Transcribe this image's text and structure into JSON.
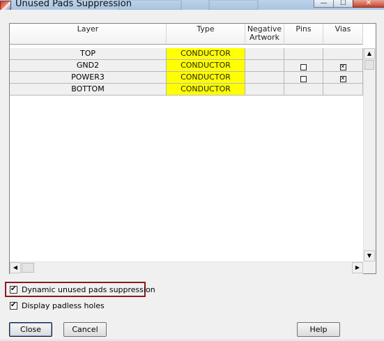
{
  "window": {
    "title": "Unused Pads Suppression",
    "controls": {
      "minimize": "—",
      "maximize": "☐",
      "close": "✕"
    }
  },
  "table": {
    "columns": [
      "Layer",
      "Type",
      "Negative\nArtwork",
      "Pins",
      "Vias"
    ],
    "rows": [
      {
        "layer": "TOP",
        "type": "CONDUCTOR",
        "negative": "",
        "pins": null,
        "vias": null
      },
      {
        "layer": "GND2",
        "type": "CONDUCTOR",
        "negative": "",
        "pins": false,
        "vias": true
      },
      {
        "layer": "POWER3",
        "type": "CONDUCTOR",
        "negative": "",
        "pins": false,
        "vias": true
      },
      {
        "layer": "BOTTOM",
        "type": "CONDUCTOR",
        "negative": "",
        "pins": null,
        "vias": null
      }
    ]
  },
  "scrollbar": {
    "up": "▲",
    "down": "▼",
    "left": "◀",
    "right": "▶"
  },
  "options": {
    "dynamic_label": "Dynamic unused pads suppression",
    "dynamic_checked": true,
    "padless_label": "Display padless holes",
    "padless_checked": true
  },
  "buttons": {
    "close": "Close",
    "cancel": "Cancel",
    "help": "Help"
  },
  "colors": {
    "type_cell": "#ffff00",
    "highlight": "#8b1a1a"
  }
}
